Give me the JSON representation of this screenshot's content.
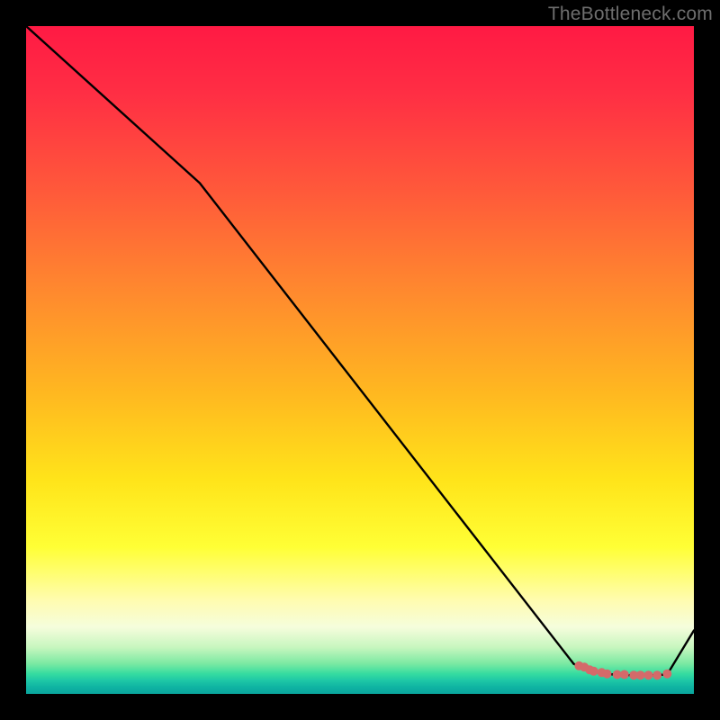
{
  "watermark": "TheBottleneck.com",
  "chart_data": {
    "type": "line",
    "title": "",
    "xlabel": "",
    "ylabel": "",
    "xlim": [
      0,
      100
    ],
    "ylim": [
      0,
      100
    ],
    "grid": false,
    "legend": "none",
    "series": [
      {
        "name": "bottleneck-curve",
        "color": "#000000",
        "x": [
          0,
          26,
          82,
          84,
          86,
          88,
          90,
          92,
          94,
          96,
          100
        ],
        "values": [
          100,
          76.5,
          4.5,
          3.6,
          3.1,
          2.9,
          2.8,
          2.8,
          2.8,
          2.9,
          9.5
        ]
      }
    ],
    "markers": [
      {
        "cluster": "valley-dots",
        "color": "#d46a6a",
        "points": [
          {
            "x": 82.8,
            "y": 4.2
          },
          {
            "x": 83.6,
            "y": 4.0
          },
          {
            "x": 84.4,
            "y": 3.6
          },
          {
            "x": 85.0,
            "y": 3.4
          },
          {
            "x": 86.2,
            "y": 3.2
          },
          {
            "x": 87.0,
            "y": 3.0
          },
          {
            "x": 88.5,
            "y": 2.9
          },
          {
            "x": 89.6,
            "y": 2.9
          },
          {
            "x": 91.0,
            "y": 2.8
          },
          {
            "x": 92.0,
            "y": 2.8
          },
          {
            "x": 93.2,
            "y": 2.8
          },
          {
            "x": 94.5,
            "y": 2.8
          },
          {
            "x": 96.0,
            "y": 3.0
          }
        ]
      }
    ]
  }
}
